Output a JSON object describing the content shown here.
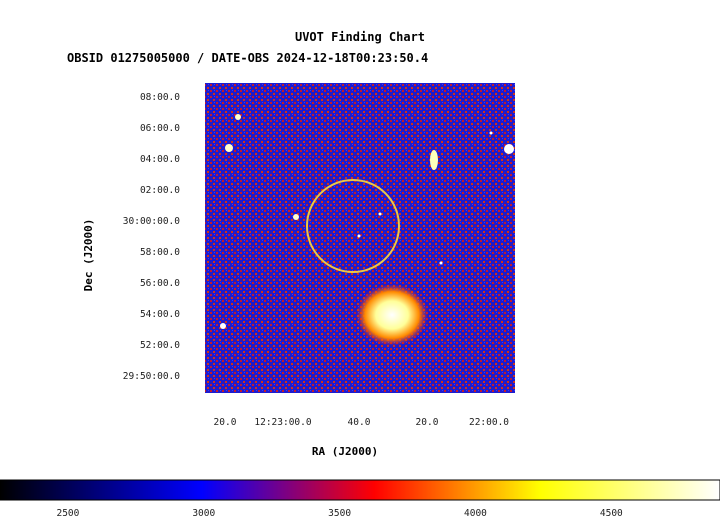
{
  "chart_data": {
    "type": "heatmap",
    "title": "UVOT Finding Chart",
    "subtitle": "OBSID 01275005000 / DATE-OBS 2024-12-18T00:23:50.4",
    "xlabel": "RA (J2000)",
    "ylabel": "Dec (J2000)",
    "x_ticks": [
      "20.0",
      "12:23:00.0",
      "40.0",
      "20.0",
      "22:00.0"
    ],
    "y_ticks": [
      "08:00.0",
      "06:00.0",
      "04:00.0",
      "02:00.0",
      "30:00:00.0",
      "58:00.0",
      "56:00.0",
      "54:00.0",
      "52:00.0",
      "29:50:00.0"
    ],
    "colorbar": {
      "ticks": [
        2500,
        3000,
        3500,
        4000,
        4500
      ],
      "range": [
        2250,
        4900
      ],
      "colors": [
        "#000000",
        "#0000ff",
        "#ff0000",
        "#ffff00",
        "#ffffff"
      ]
    },
    "region": {
      "shape": "circle",
      "color": "#e8c84a"
    },
    "grid": false
  }
}
